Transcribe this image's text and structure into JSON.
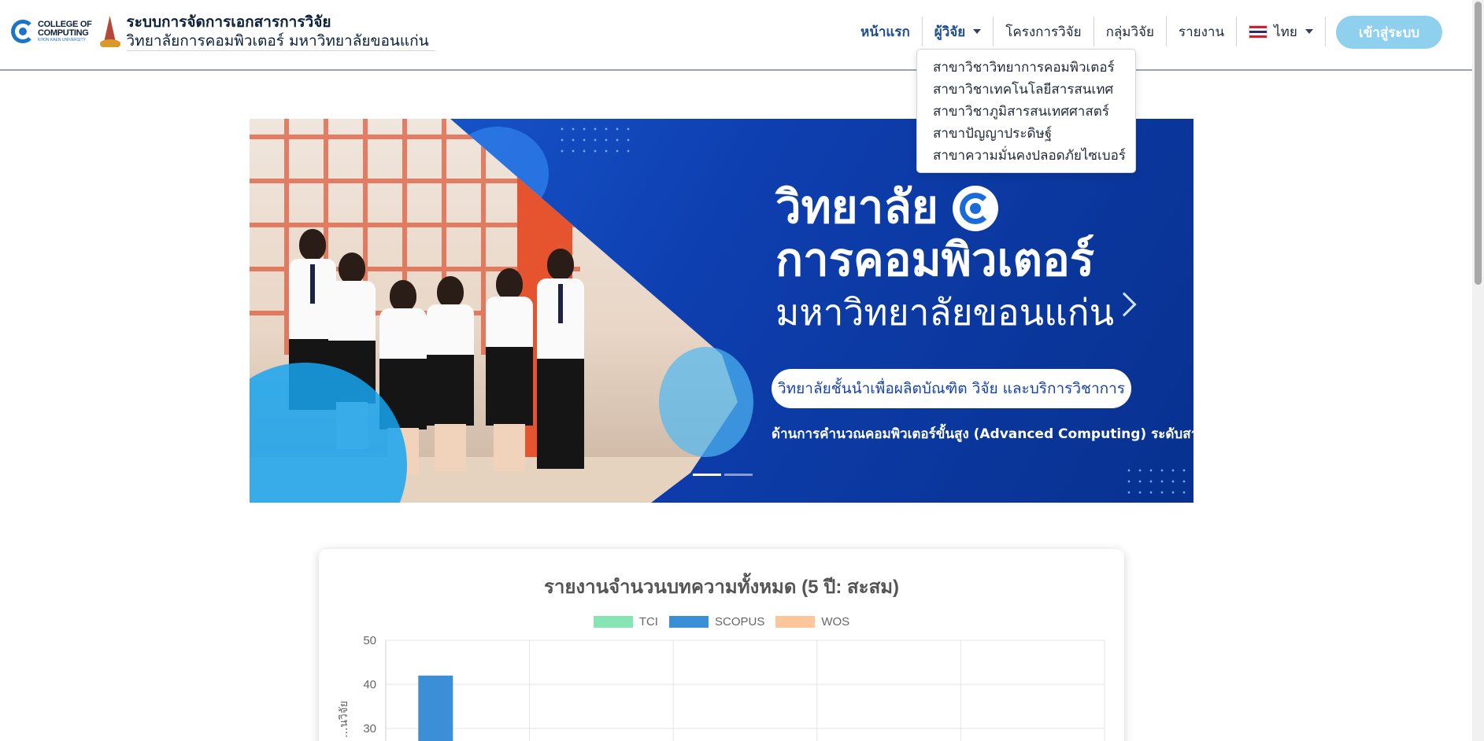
{
  "brand": {
    "logo_line1": "COLLEGE OF",
    "logo_line2": "COMPUTING",
    "logo_line3": "KHON KAEN UNIVERSITY",
    "title": "ระบบการจัดการเอกสารการวิจัย",
    "subtitle": "วิทยาลัยการคอมพิวเตอร์ มหาวิทยาลัยขอนแก่น"
  },
  "nav": {
    "home": "หน้าแรก",
    "researchers": "ผู้วิจัย",
    "projects": "โครงการวิจัย",
    "groups": "กลุ่มวิจัย",
    "reports": "รายงาน",
    "language": "ไทย",
    "login": "เข้าสู่ระบบ"
  },
  "dropdown": {
    "items": [
      "สาขาวิชาวิทยาการคอมพิวเตอร์",
      "สาขาวิชาเทคโนโลยีสารสนเทศ",
      "สาขาวิชาภูมิสารสนเทศศาสตร์",
      "สาขาปัญญาประดิษฐ์",
      "สาขาความมั่นคงปลอดภัยไซเบอร์"
    ]
  },
  "hero": {
    "title_line1": "วิทยาลัย",
    "title_line2": "การคอมพิวเตอร์",
    "title_line3": "มหาวิทยาลัยขอนแก่น",
    "pill": "วิทยาลัยชั้นนำเพื่อผลิตบัณฑิต วิจัย  และบริการวิชาการ",
    "caption": "ด้านการคำนวณคอมพิวเตอร์ขั้นสูง (Advanced Computing) ระดับสากล",
    "active_slide": 1,
    "slide_count": 2
  },
  "chart_data": {
    "type": "bar",
    "title": "รายงานจำนวนบทความทั้งหมด (5 ปี: สะสม)",
    "ylabel": "...นวิจัย",
    "ylim": [
      0,
      50
    ],
    "yticks": [
      50,
      40,
      30
    ],
    "categories": [
      "",
      "",
      "",
      "",
      ""
    ],
    "series": [
      {
        "name": "TCI",
        "color": "#86e5b3",
        "values": [
          null,
          null,
          null,
          null,
          null
        ]
      },
      {
        "name": "SCOPUS",
        "color": "#3b8fd6",
        "values": [
          42,
          null,
          null,
          null,
          null
        ]
      },
      {
        "name": "WOS",
        "color": "#ffc59b",
        "values": [
          null,
          null,
          null,
          null,
          null
        ]
      }
    ],
    "legend_position": "top",
    "grid": true
  }
}
